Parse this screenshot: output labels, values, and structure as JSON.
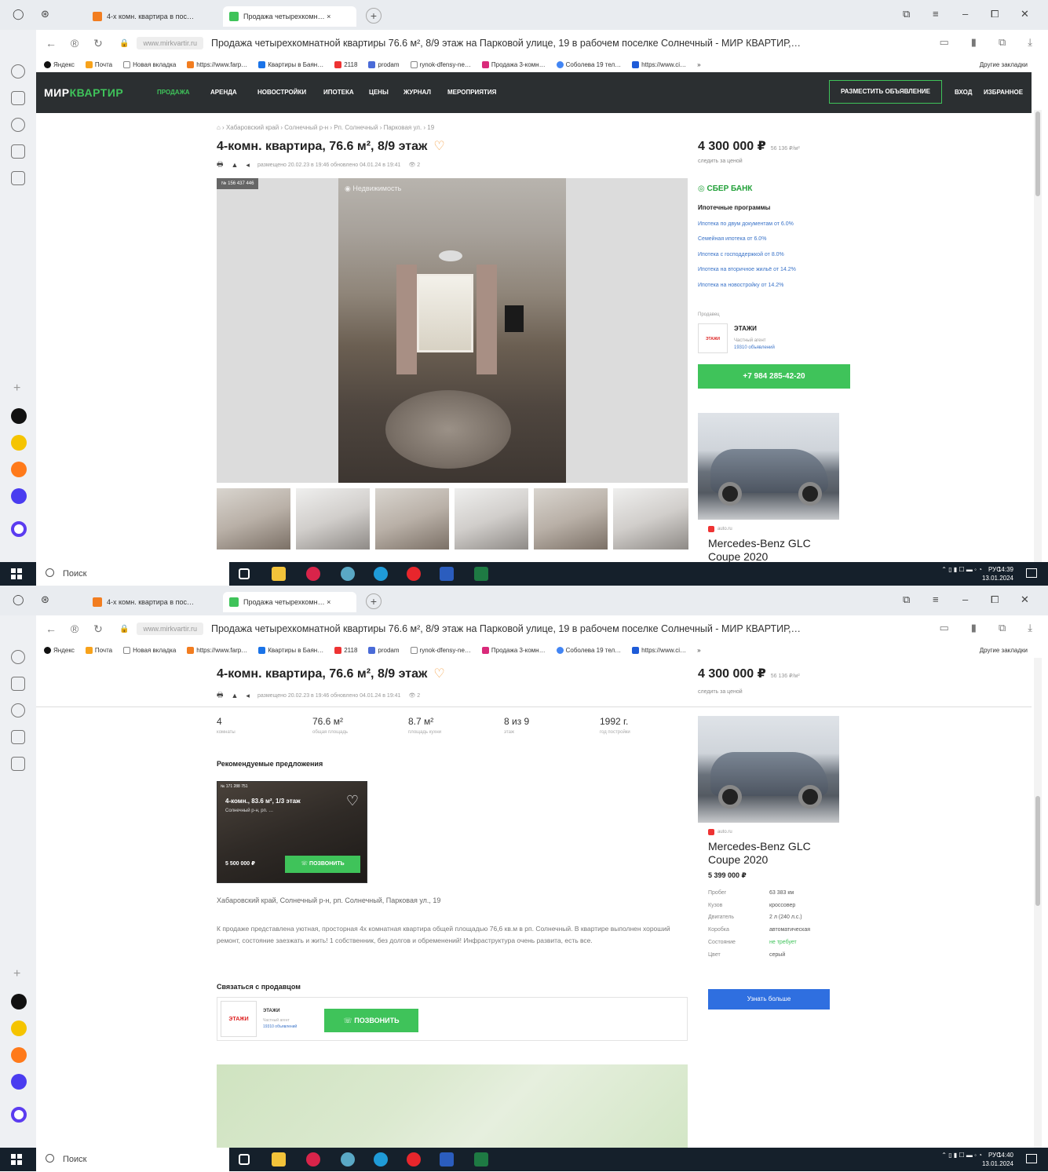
{
  "browser": {
    "tabs": [
      {
        "label": "4-х комн. квартира в пос…"
      },
      {
        "label": "Продажа четырехкомн… ×"
      }
    ],
    "domain": "www.mirkvartir.ru",
    "page_title": "Продажа четырехкомнатной квартиры 76.6 м², 8/9 этаж на Парковой улице, 19 в рабочем поселке Солнечный - МИР КВАРТИР,…",
    "bookmarks": [
      "Яндекс",
      "Почта",
      "Новая вкладка",
      "https://www.farp…",
      "Квартиры в Баян…",
      "2118",
      "prodam",
      "rynok-dfensy-ne…",
      "Продажа 3-комн…",
      "Соболева 19 тел…",
      "https://www.ci…"
    ],
    "bookmarks_more": "»",
    "other_bookmarks": "Другие закладки"
  },
  "site": {
    "logo_part1": "МИР",
    "logo_part2": "КВАРТИР",
    "nav": [
      "продажа",
      "аренда",
      "новостройки",
      "ипотека",
      "цены",
      "журнал",
      "мероприятия"
    ],
    "post_button": "РАЗМЕСТИТЬ ОБЪЯВЛЕНИЕ",
    "login": "ВХОД",
    "favorites": "ИЗБРАННОЕ"
  },
  "listing": {
    "breadcrumbs": "⌂ › Хабаровский край › Солнечный р-н › Рп. Солнечный › Парковая ул. › 19",
    "title": "4-комн. квартира, 76.6 м², 8/9 этаж",
    "heart": "♡",
    "meta": "размещено 20.02.23 в 19:46 обновлено 04.01.24 в 19:41",
    "views": "👁 2",
    "price": "4 300 000 ₽",
    "price_per_m": "56 136 ₽/м²",
    "track_price": "следить за ценой",
    "photo_id": "№ 156 437 446",
    "photo_watermark": "Недвижимость",
    "stats": [
      {
        "value": "4",
        "label": "комнаты"
      },
      {
        "value": "76.6 м²",
        "label": "общая площадь"
      },
      {
        "value": "8.7 м²",
        "label": "площадь кухни"
      },
      {
        "value": "8 из 9",
        "label": "этаж"
      },
      {
        "value": "1992 г.",
        "label": "год постройки"
      }
    ],
    "recommended_title": "Рекомендуемые предложения",
    "recommended": {
      "id": "№ 171 288 751",
      "title": "4-комн., 83.6 м², 1/3 этаж",
      "subtitle": "Солнечный р-н, рп. …",
      "price": "5 500 000 ₽",
      "call": "ПОЗВОНИТЬ"
    },
    "address": "Хабаровский край, Солнечный р-н, рп. Солнечный, Парковая ул., 19",
    "description": "К продаже представлена уютная, просторная 4х комнатная квартира общей площадью 76,6 кв.м в рп. Солнечный. В квартире выполнен хороший ремонт, состояние заезжать и жить! 1 собственник, без долгов и обременений! Инфраструктура очень развита, есть все.",
    "contact_title": "Связаться с продавцом",
    "seller_logo": "ЭТАЖИ",
    "seller_name": "ЭТАЖИ",
    "seller_sub": "Частный агент",
    "seller_link": "19310 объявлений",
    "call": "ПОЗВОНИТЬ"
  },
  "sidebar_right": {
    "bank": "СБЕР БАНК",
    "mortgage_title": "Ипотечные программы",
    "mortgage_links": [
      "Ипотека по двум документам от 6.0%",
      "Семейная ипотека от 6.0%",
      "Ипотека с господдержкой от 8.0%",
      "Ипотека на вторичное жильё от 14.2%",
      "Ипотека на новостройку от 14.2%"
    ],
    "seller_label": "Продавец",
    "seller_name": "ЭТАЖИ",
    "seller_sub": "Частный агент",
    "seller_link": "19310 объявлений",
    "seller_logo": "ЭТАЖИ",
    "phone": "+7 984 285-42-20",
    "ad": {
      "source": "auto.ru",
      "title": "Mercedes-Benz GLC Coupe 2020",
      "price": "5 399 000 ₽",
      "specs": [
        {
          "k": "Пробег",
          "v": "63 383 км"
        },
        {
          "k": "Кузов",
          "v": "кроссовер"
        },
        {
          "k": "Двигатель",
          "v": "2 л (240 л.с.)"
        },
        {
          "k": "Коробка",
          "v": "автоматическая"
        },
        {
          "k": "Состояние",
          "v": "не требует"
        },
        {
          "k": "Цвет",
          "v": "серый"
        }
      ],
      "more": "Узнать больше"
    }
  },
  "taskbar": {
    "search": "Поиск",
    "lang": "РУС",
    "time1": "14:39",
    "date1": "13.01.2024",
    "time2": "14:40",
    "date2": "13.01.2024"
  }
}
